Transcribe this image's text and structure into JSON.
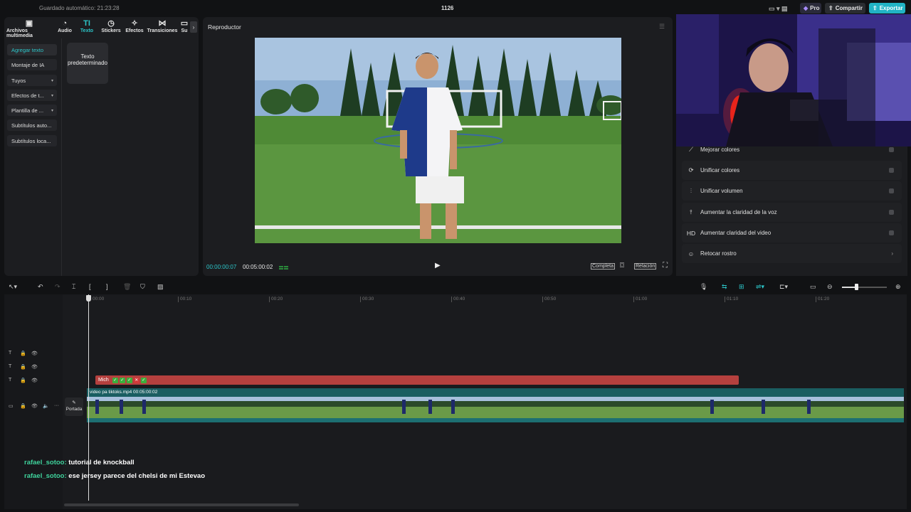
{
  "topbar": {
    "autosave": "Guardado automático: 21:23:28",
    "project_name": "1126",
    "pro_label": "Pro",
    "share_label": "Compartir",
    "export_label": "Exportar"
  },
  "media_tabs": [
    {
      "label": "Archivos multimedia",
      "icon": "media-icon"
    },
    {
      "label": "Audio",
      "icon": "audio-icon"
    },
    {
      "label": "Texto",
      "icon": "text-icon"
    },
    {
      "label": "Stickers",
      "icon": "sticker-icon"
    },
    {
      "label": "Efectos",
      "icon": "effects-icon"
    },
    {
      "label": "Transiciones",
      "icon": "transitions-icon"
    },
    {
      "label": "Su",
      "icon": "subtitles-icon"
    }
  ],
  "text_sidebar": [
    {
      "label": "Agregar texto"
    },
    {
      "label": "Montaje de IA"
    },
    {
      "label": "Tuyos"
    },
    {
      "label": "Efectos de t..."
    },
    {
      "label": "Plantilla de ..."
    },
    {
      "label": "Subtítulos auto..."
    },
    {
      "label": "Subtítulos loca..."
    }
  ],
  "default_text_card": "Texto predeterminado",
  "player": {
    "title": "Reproductor",
    "current_time": "00:00:00:07",
    "total_time": "00:05:00:02",
    "complete_label": "Completa",
    "ratio_label": "Relación"
  },
  "right_panel_items": [
    {
      "label": "Mejorar colores",
      "icon": "wand-icon"
    },
    {
      "label": "Unificar colores",
      "icon": "palette-icon"
    },
    {
      "label": "Unificar volumen",
      "icon": "volume-levels-icon"
    },
    {
      "label": "Aumentar la claridad de la voz",
      "icon": "voice-icon"
    },
    {
      "label": "Aumentar claridad del video",
      "icon": "hd-icon"
    },
    {
      "label": "Retocar rostro",
      "icon": "face-icon"
    }
  ],
  "timeline": {
    "ruler": [
      "00:00",
      "00:10",
      "00:20",
      "00:30",
      "00:40",
      "00:50",
      "01:00",
      "01:10",
      "01:20"
    ],
    "text_clip_label": "Mich",
    "video_clip_label": "video pa tiktoks.mp4   00:05:00:02",
    "cover_label": "Portada"
  },
  "chat": [
    {
      "user": "rafael_sotoo:",
      "message": "tutorial de knockball"
    },
    {
      "user": "rafael_sotoo:",
      "message": "ese jersey parece del chelsi de mi Estevao"
    }
  ],
  "colors": {
    "accent": "#2cc6c9",
    "export": "#21b3c4",
    "text_clip": "#b5403e",
    "video_clip": "#1a5e61"
  }
}
